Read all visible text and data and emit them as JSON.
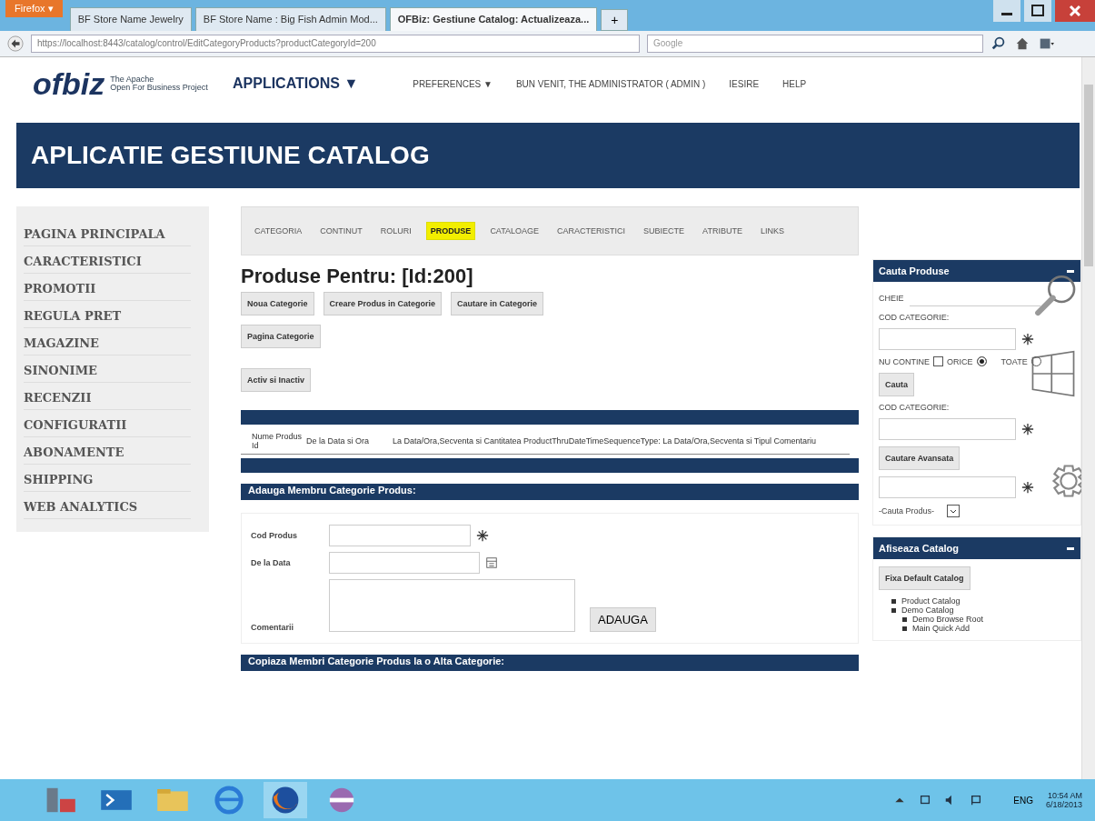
{
  "browser": {
    "menu_button": "Firefox ▾",
    "tabs": [
      {
        "title": "BF Store Name Jewelry",
        "selected": false
      },
      {
        "title": "BF Store Name : Big Fish Admin Mod...",
        "selected": false
      },
      {
        "title": "OFBiz: Gestiune Catalog: Actualizeaza...",
        "selected": true
      }
    ],
    "new_tab": "+",
    "url": "https://localhost:8443/catalog/control/EditCategoryProducts?productCategoryId=200",
    "search_placeholder": "Google"
  },
  "header": {
    "logo": "ofbiz",
    "tagline_1": "The Apache",
    "tagline_2": "Open For Business Project",
    "menus": [
      {
        "label": "APPLICATIONS ▼",
        "kind": "big"
      },
      {
        "label": "PREFERENCES ▼",
        "kind": "small"
      },
      {
        "label": "BUN VENIT, THE ADMINISTRATOR ( ADMIN )",
        "kind": "small"
      },
      {
        "label": "IESIRE",
        "kind": "small"
      },
      {
        "label": "HELP",
        "kind": "small"
      }
    ]
  },
  "banner": "APLICATIE GESTIUNE CATALOG",
  "sidebar": {
    "items": [
      "PAGINA PRINCIPALA",
      "CARACTERISTICI",
      "PROMOTII",
      "REGULA PRET",
      "MAGAZINE",
      "SINONIME",
      "RECENZII",
      "CONFIGURATII",
      "ABONAMENTE",
      "SHIPPING",
      "WEB ANALYTICS"
    ]
  },
  "subtabs": [
    {
      "label": "CATEGORIA",
      "selected": false
    },
    {
      "label": "CONTINUT",
      "selected": false
    },
    {
      "label": "ROLURI",
      "selected": false
    },
    {
      "label": "PRODUSE",
      "selected": true
    },
    {
      "label": "CATALOAGE",
      "selected": false
    },
    {
      "label": "CARACTERISTICI",
      "selected": false
    },
    {
      "label": "SUBIECTE",
      "selected": false
    },
    {
      "label": "ATRIBUTE",
      "selected": false
    },
    {
      "label": "LINKS",
      "selected": false
    }
  ],
  "heading": "Produse Pentru: [Id:200]",
  "button_groups": [
    [
      "Noua Categorie",
      "Creare Produs in Categorie",
      "Cautare in Categorie"
    ],
    [
      "Pagina Categorie"
    ],
    [
      "Activ si Inactiv"
    ]
  ],
  "table": {
    "columns": [
      "Nume Produs Id",
      "De la Data si Ora",
      "La Data/Ora,Secventa si Cantitatea ProductThruDateTimeSequenceType: La Data/Ora,Secventa si Tipul Comentariu"
    ]
  },
  "add_form": {
    "title": "Adauga Membru Categorie Produs:",
    "fields": [
      {
        "label": "Cod Produs",
        "kind": "lookup"
      },
      {
        "label": "De la Data",
        "kind": "date"
      },
      {
        "label": "Comentarii",
        "kind": "textarea"
      }
    ],
    "submit": "ADAUGA"
  },
  "copy_section": {
    "title": "Copiaza Membri Categorie Produs la o Alta Categorie:"
  },
  "search_panel": {
    "title": "Cauta Produse",
    "keyword_label": "CHEIE",
    "category_label": "COD CATEGORIE:",
    "not_contains": {
      "label": "NU CONTINE",
      "checked": false
    },
    "modes": [
      {
        "label": "ORICE",
        "selected": true
      },
      {
        "label": "TOATE",
        "selected": false
      }
    ],
    "search_button": "Cauta",
    "category_id_label": "COD CATEGORIE:",
    "advanced_button": "Cautare Avansata",
    "select": "-Cauta Produs-"
  },
  "catalog_panel": {
    "title": "Afiseaza Catalog",
    "button": "Fixa Default Catalog",
    "items": [
      {
        "label": "Product Catalog"
      },
      {
        "label": "Demo Catalog",
        "children": [
          {
            "label": "Demo Browse Root"
          },
          {
            "label": "Main Quick Add"
          }
        ]
      }
    ]
  },
  "taskbar": {
    "language": "ENG",
    "time": "10:54 AM",
    "date": "6/18/2013"
  }
}
